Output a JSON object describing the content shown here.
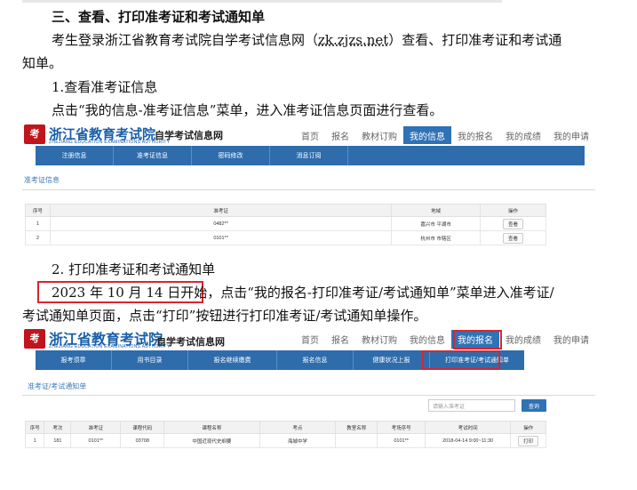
{
  "doc": {
    "heading": "三、查看、打印准考证和考试通知单",
    "intro_a": "考生登录浙江省教育考试院自学考试信息网（",
    "intro_link": "zk.zjzs.net",
    "intro_b": "）查看、打印准考证和考试通",
    "intro_c": "知单。",
    "step1_title": "1.查看准考证信息",
    "step1_desc": "点击“我的信息-准考证信息”菜单，进入准考证信息页面进行查看。",
    "step2_title": "2. 打印准考证和考试通知单",
    "step2_date": "2023 年 10 月 14 日开始",
    "step2_desc_a": "，点击“我的报名-打印准考证/考试通知单”菜单进入准考证/",
    "step2_desc_b": "考试通知单页面，点击“打印”按钮进行打印准考证/考试通知单操作。"
  },
  "site": {
    "logo_mark": "考",
    "name_cn": "浙江省教育考试院",
    "name_en": "ZHEJIANG EDUCATION EXAMINATIONS AUTHORITY",
    "sub_title": "自学考试信息网",
    "topnav": [
      "首页",
      "报名",
      "教材订购",
      "我的信息",
      "我的报名",
      "我的成绩",
      "我的申请"
    ]
  },
  "shot1": {
    "active_nav": 3,
    "subnav": [
      "注册信息",
      "准考证信息",
      "密码修改",
      "消息订阅"
    ],
    "section_title": "准考证信息",
    "headers": [
      "序号",
      "准考证",
      "地域",
      "操作"
    ],
    "rows": [
      {
        "no": "1",
        "ticket": "0482**",
        "region": "嘉兴市 平湖市",
        "action": "查看"
      },
      {
        "no": "2",
        "ticket": "0101**",
        "region": "杭州市 市辖区",
        "action": "查看"
      }
    ]
  },
  "shot2": {
    "active_nav": 4,
    "subnav": [
      "报考须章",
      "用书目录",
      "报名继续缴费",
      "报名信息",
      "健康状况上报",
      "打印准考证/考试通知单"
    ],
    "section_title": "准考证/考试通知单",
    "search_placeholder": "请输入准考证",
    "search_button": "查询",
    "headers": [
      "序号",
      "考次",
      "准考证",
      "课程代码",
      "课程名称",
      "考点",
      "教室名称",
      "考场序号",
      "考试时间",
      "操作"
    ],
    "rows": [
      {
        "no": "1",
        "session": "181",
        "ticket": "0101**",
        "code": "03708",
        "course": "中国近现代史纲要",
        "site": "海城中学",
        "room": "",
        "seat": "0101**",
        "time": "2018-04-14 9:00~11:30",
        "action": "打印"
      }
    ]
  },
  "colors": {
    "brand_blue": "#2e6cac",
    "highlight_red": "#d9252f"
  }
}
